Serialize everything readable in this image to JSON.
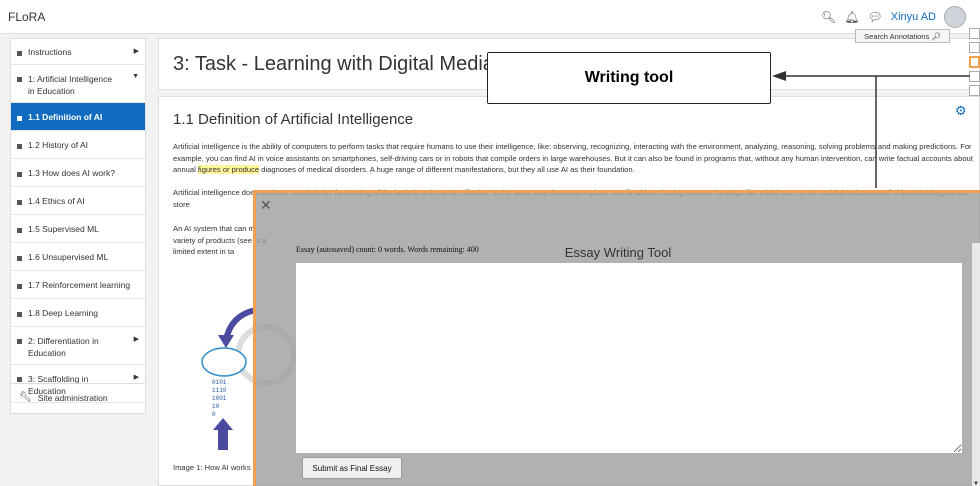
{
  "navbar": {
    "brand": "FLoRA",
    "user_name": "Xinyu AD"
  },
  "sidebar": {
    "items": [
      {
        "label": "Instructions",
        "has_arrow": true,
        "arrow": "▶"
      },
      {
        "label": "1: Artificial Intelligence in Education",
        "has_arrow": true,
        "arrow": "▼"
      },
      {
        "label": "1.1 Definition of AI",
        "active": true
      },
      {
        "label": "1.2 History of AI"
      },
      {
        "label": "1.3 How does AI work?"
      },
      {
        "label": "1.4 Ethics of AI"
      },
      {
        "label": "1.5 Supervised ML"
      },
      {
        "label": "1.6 Unsupervised ML"
      },
      {
        "label": "1.7 Reinforcement learning"
      },
      {
        "label": "1.8 Deep Learning"
      },
      {
        "label": "2: Differentiation in Education",
        "has_arrow": true,
        "arrow": "▶"
      },
      {
        "label": "3: Scaffolding in Education",
        "has_arrow": true,
        "arrow": "▶"
      }
    ],
    "admin": "Site administration"
  },
  "header": {
    "title": "3: Task - Learning with Digital Media",
    "search_annotations": "Search Annotations"
  },
  "content": {
    "section_title": "1.1 Definition of Artificial Intelligence",
    "para1_a": "Artificial intelligence is the ability of computers to perform tasks that require humans to use their intelligence, like: observing, recognizing, interacting with the environment, analyzing, reasoning, solving problems and making predictions. For example, you can find AI in voice assistants on smartphones, self-driving cars or in robots that compile orders in large warehouses. But it can also be found in programs that, without any human intervention, can write factual accounts about annual ",
    "para1_hl": "figures or produce",
    "para1_b": " diagnoses of medical disorders. A huge range of different manifestations, but they all use AI as their foundation.",
    "para2": "Artificial intelligence does not have to mimic the functioning of the brain in order to be effective, in the same way that an aeroplane can fly without having to move its wings like a bird. Due to the rapid development of chip technology, AI can store",
    "para3": "An AI system that can m variety of products (see to a limited extent in ta",
    "caption": "Image 1: How AI works"
  },
  "callout": {
    "label": "Writing tool"
  },
  "modal": {
    "title": "Essay Writing Tool",
    "status": "Essay (autosaved) count: 0 words. Words remaining: 400",
    "essay_value": "",
    "submit_label": "Submit as Final Essay"
  },
  "colors": {
    "primary": "#0f6cbf",
    "highlight": "#fff59a",
    "overlay_border": "#f0a050"
  }
}
